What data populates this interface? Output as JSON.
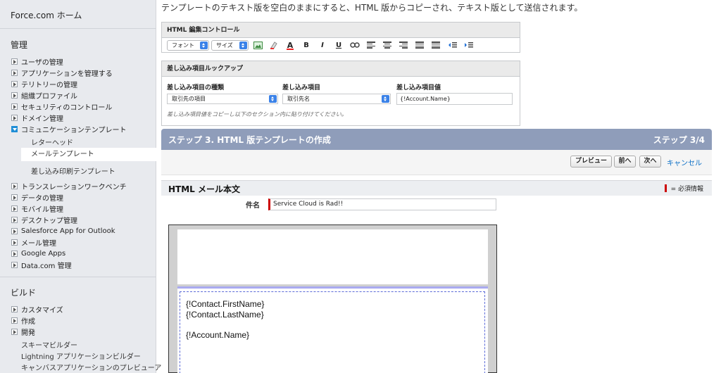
{
  "sidebar": {
    "home": "Force.com ホーム",
    "admin_title": "管理",
    "admin_items": [
      "ユーザの管理",
      "アプリケーションを管理する",
      "テリトリーの管理",
      "組織プロファイル",
      "セキュリティのコントロール",
      "ドメイン管理",
      "コミュニケーションテンプレート"
    ],
    "comm_sub": [
      "レターヘッド",
      "メールテンプレート",
      "差し込み印刷テンプレート"
    ],
    "admin_items_2": [
      "トランスレーションワークベンチ",
      "データの管理",
      "モバイル管理",
      "デスクトップ管理",
      "Salesforce App for Outlook",
      "メール管理",
      "Google Apps",
      "Data.com 管理"
    ],
    "build_title": "ビルド",
    "build_items": [
      "カスタマイズ",
      "作成",
      "開発"
    ],
    "build_plain": [
      "スキーマビルダー",
      "Lightning アプリケーションビルダー",
      "キャンバスアプリケーションのプレビューア"
    ]
  },
  "main": {
    "intro": "テンプレートのテキスト版を空白のままにすると、HTML 版からコピーされ、テキスト版として送信されます。",
    "html_editor": {
      "title": "HTML 編集コントロール",
      "font_label": "フォント",
      "size_label": "サイズ"
    },
    "merge": {
      "title": "差し込み項目ルックアップ",
      "type_label": "差し込み項目の種類",
      "type_value": "取引先の項目",
      "field_label": "差し込み項目",
      "field_value": "取引先名",
      "value_label": "差し込み項目値",
      "value_value": "{!Account.Name}",
      "hint": "差し込み項目値をコピーし以下のセクション内に貼り付けてください。"
    },
    "step": {
      "title": "ステップ 3. HTML 版テンプレートの作成",
      "count": "ステップ 3/4"
    },
    "buttons": {
      "preview": "プレビュー",
      "prev": "前へ",
      "next": "次へ",
      "cancel": "キャンセル"
    },
    "section": {
      "title": "HTML メール本文",
      "required": "= 必須情報"
    },
    "subject": {
      "label": "件名",
      "value": "Service Cloud is Rad!!"
    },
    "editor_text": "{!Contact.FirstName}\n{!Contact.LastName}\n\n{!Account.Name}"
  },
  "colors": {
    "step_bar": "#8f9dba",
    "required": "#cc0000",
    "link": "#0b6fc6",
    "select_arrow": "#3b82e8"
  }
}
